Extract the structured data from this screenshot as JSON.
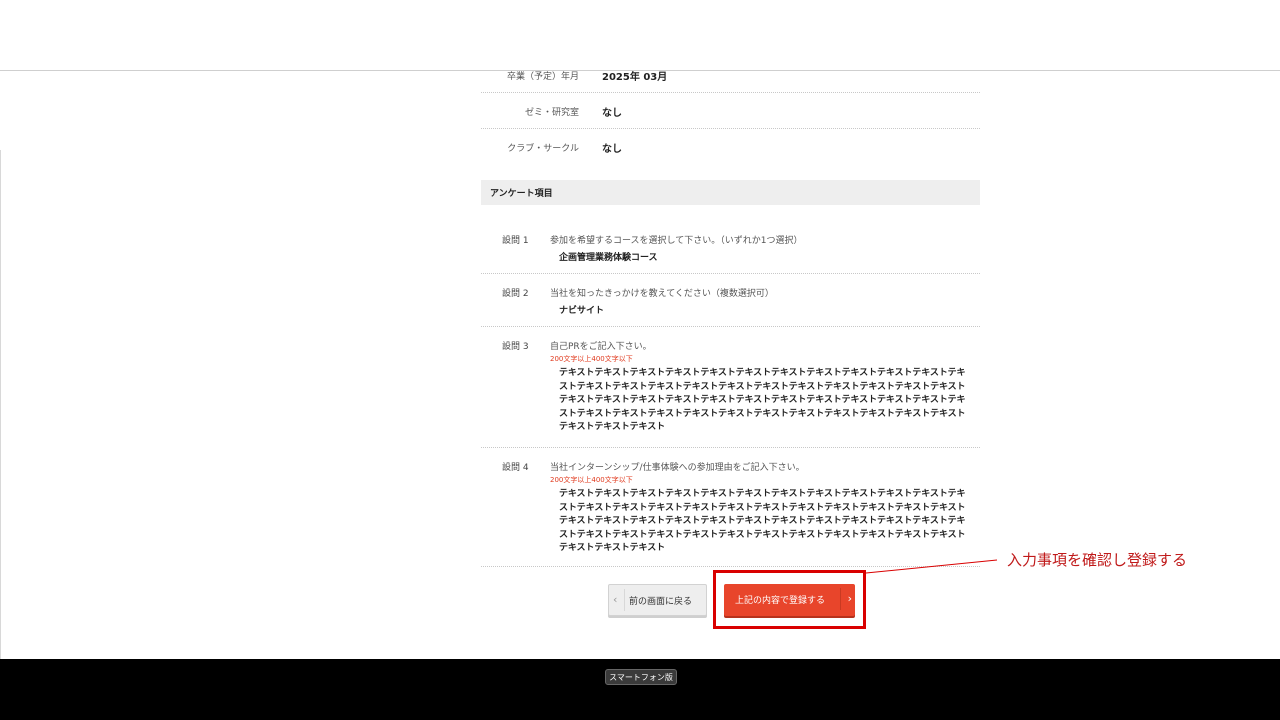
{
  "profile": {
    "rows": [
      {
        "label": "卒業（予定）年月",
        "value": "2025年 03月"
      },
      {
        "label": "ゼミ・研究室",
        "value": "なし"
      },
      {
        "label": "クラブ・サークル",
        "value": "なし"
      }
    ]
  },
  "survey": {
    "header": "アンケート項目",
    "questions": [
      {
        "num": "設問 1",
        "text": "参加を希望するコースを選択して下さい。（いずれか1つ選択）",
        "answer": "企画管理業務体験コース"
      },
      {
        "num": "設問 2",
        "text": "当社を知ったきっかけを教えてください（複数選択可）",
        "answer": "ナビサイト"
      },
      {
        "num": "設問 3",
        "text": "自己PRをご記入下さい。",
        "requirement": "200文字以上400文字以下",
        "answer": "テキストテキストテキストテキストテキストテキストテキストテキストテキストテキストテキストテキストテキストテキストテキストテキストテキストテキストテキストテキストテキストテキストテキストテキストテキストテキストテキストテキストテキストテキストテキストテキストテキストテキストテキストテキストテキストテキストテキストテキストテキストテキストテキストテキストテキストテキストテキストテキストテキスト"
      },
      {
        "num": "設問 4",
        "text": "当社インターンシップ/仕事体験への参加理由をご記入下さい。",
        "requirement": "200文字以上400文字以下",
        "answer": "テキストテキストテキストテキストテキストテキストテキストテキストテキストテキストテキストテキストテキストテキストテキストテキストテキストテキストテキストテキストテキストテキストテキストテキストテキストテキストテキストテキストテキストテキストテキストテキストテキストテキストテキストテキストテキストテキストテキストテキストテキストテキストテキストテキストテキストテキストテキストテキストテキスト"
      }
    ]
  },
  "actions": {
    "back_label": "前の画面に戻る",
    "submit_label": "上記の内容で登録する"
  },
  "annotation": {
    "text": "入力事項を確認し登録する",
    "color": "#d90000"
  },
  "footer": {
    "smartphone_label": "スマートフォン版"
  },
  "icons": {
    "back": "chevron-left-icon",
    "submit": "chevron-right-icon"
  }
}
